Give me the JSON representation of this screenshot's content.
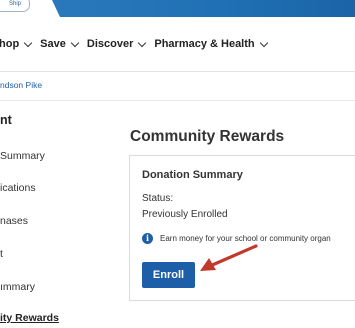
{
  "topbar": {
    "pill_text": "Ship"
  },
  "nav": {
    "items": [
      {
        "label": "hop"
      },
      {
        "label": "Save"
      },
      {
        "label": "Discover"
      },
      {
        "label": "Pharmacy & Health"
      }
    ]
  },
  "store": {
    "name": "ndson Pike"
  },
  "sidebar": {
    "heading": "nt",
    "items": [
      {
        "label": "Summary"
      },
      {
        "label": "ications"
      },
      {
        "label": "nases"
      },
      {
        "label": "t"
      },
      {
        "label": "ımmary"
      },
      {
        "label": "ity Rewards"
      }
    ]
  },
  "main": {
    "title": "Community Rewards",
    "card": {
      "title": "Donation Summary",
      "status_label": "Status:",
      "status_value": "Previously Enrolled",
      "info_text": "Earn money for your school or community organ",
      "enroll_label": "Enroll"
    }
  },
  "colors": {
    "brand_blue": "#1c5fa8",
    "annotation_arrow": "#c0392b"
  }
}
